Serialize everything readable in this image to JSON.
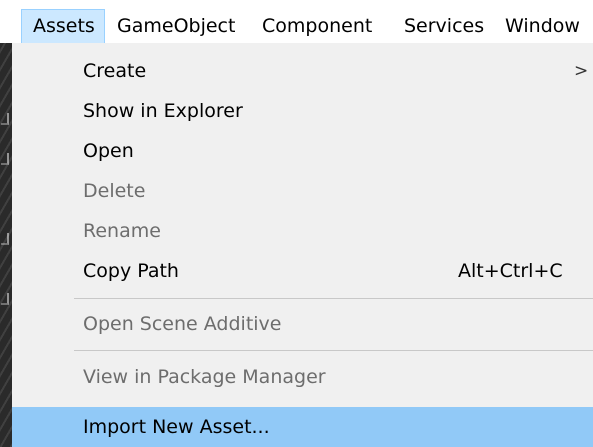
{
  "menubar": {
    "items": [
      {
        "label": "Assets",
        "active": true
      },
      {
        "label": "GameObject"
      },
      {
        "label": "Component"
      },
      {
        "label": "Services"
      },
      {
        "label": "Window"
      }
    ]
  },
  "dropdown": {
    "items": [
      {
        "label": "Create",
        "submenu": true,
        "arrow": ">"
      },
      {
        "label": "Show in Explorer"
      },
      {
        "label": "Open"
      },
      {
        "label": "Delete",
        "disabled": true
      },
      {
        "label": "Rename",
        "disabled": true
      },
      {
        "label": "Copy Path",
        "shortcut": "Alt+Ctrl+C"
      },
      {
        "label": "Open Scene Additive",
        "disabled": true
      },
      {
        "label": "View in Package Manager",
        "disabled": true
      },
      {
        "label": "Import New Asset...",
        "highlighted": true
      }
    ]
  },
  "colors": {
    "menubar_active": "#cce8ff",
    "highlight": "#91c9f7",
    "disabled_text": "#6d6d6d"
  }
}
